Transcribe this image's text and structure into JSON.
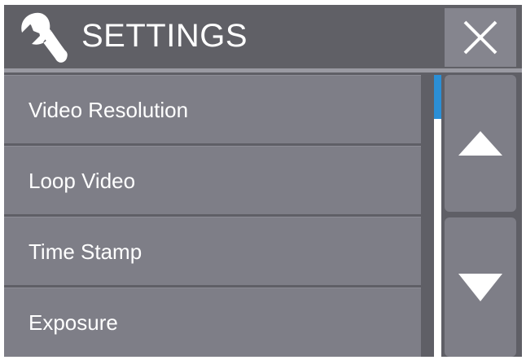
{
  "header": {
    "title": "SETTINGS",
    "icon": "wrench-icon",
    "close_icon": "close-icon"
  },
  "menu": {
    "items": [
      {
        "label": "Video Resolution"
      },
      {
        "label": "Loop Video"
      },
      {
        "label": "Time Stamp"
      },
      {
        "label": "Exposure"
      }
    ]
  },
  "scrollbar": {
    "position_fraction": 0.0,
    "thumb_color": "#2b8fd6"
  },
  "navigation": {
    "up_icon": "up-arrow-icon",
    "down_icon": "down-arrow-icon"
  },
  "colors": {
    "background": "#5f5f66",
    "item": "#7e7e87",
    "text": "#ffffff"
  }
}
